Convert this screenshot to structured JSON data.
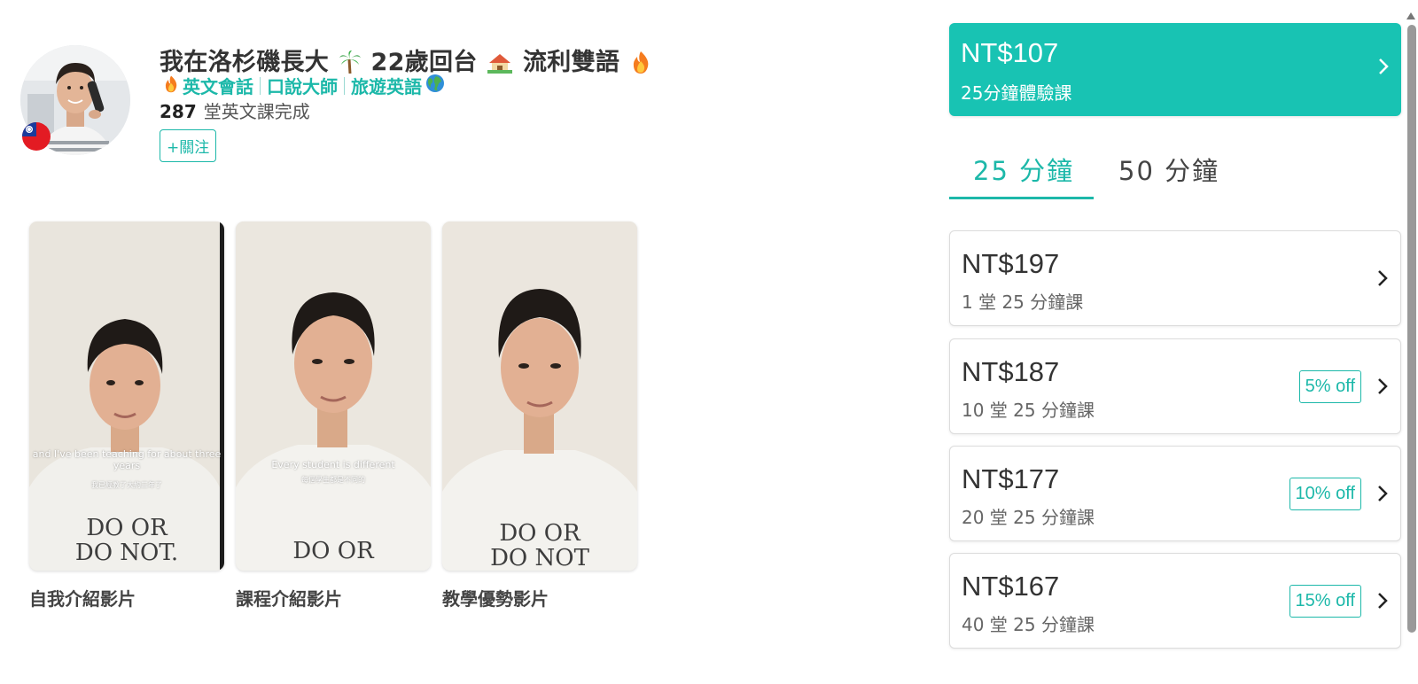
{
  "profile": {
    "name_part1": "我在洛杉磯長大",
    "name_part2": "22歲回台",
    "name_part3": "流利雙語",
    "tags": [
      "英文會話",
      "口說大師",
      "旅遊英語"
    ],
    "lesson_count": "287",
    "lesson_label": "堂英文課完成",
    "follow_label": "+關注",
    "icons": [
      "palm-tree-icon",
      "house-icon",
      "fire-icon",
      "globe-icon",
      "taiwan-flag-icon"
    ]
  },
  "videos": [
    {
      "label": "自我介紹影片",
      "caption_en": "and I've been teaching for about three years",
      "caption_zh": "我已經教了大約三年了",
      "shirt": "DO OR\nDO NOT."
    },
    {
      "label": "課程介紹影片",
      "caption_en": "Every student is different",
      "caption_zh": "每個學生都是不同的",
      "shirt": "DO OR"
    },
    {
      "label": "教學優勢影片",
      "caption_en": "",
      "caption_zh": "",
      "shirt": "DO OR\nDO NOT"
    }
  ],
  "trial": {
    "price": "NT$107",
    "desc": "25分鐘體驗課"
  },
  "tabs": {
    "active": "25 分鐘",
    "inactive": "50 分鐘"
  },
  "plans": [
    {
      "price": "NT$197",
      "desc": "1 堂 25 分鐘課",
      "discount": ""
    },
    {
      "price": "NT$187",
      "desc": "10 堂 25 分鐘課",
      "discount": "5% off"
    },
    {
      "price": "NT$177",
      "desc": "20 堂 25 分鐘課",
      "discount": "10% off"
    },
    {
      "price": "NT$167",
      "desc": "40 堂 25 分鐘課",
      "discount": "15% off"
    }
  ],
  "colors": {
    "accent": "#1cb8a9",
    "trial_bg": "#18c3b3",
    "text": "#333333"
  }
}
